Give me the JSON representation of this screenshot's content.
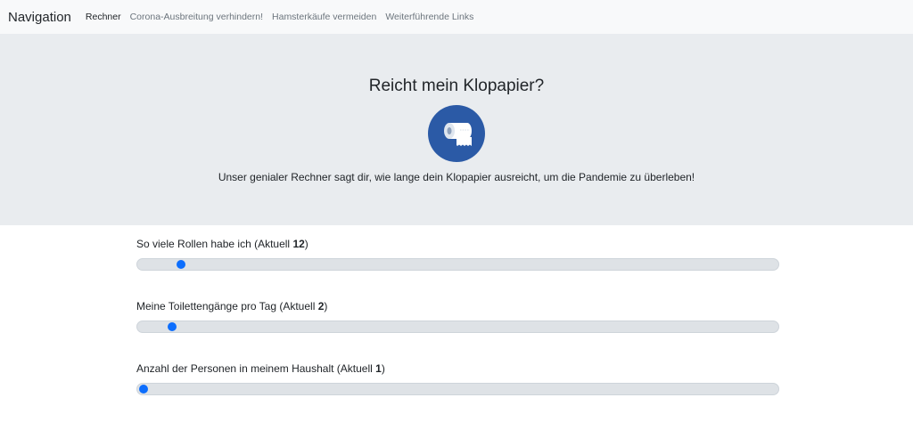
{
  "navbar": {
    "brand": "Navigation",
    "links": [
      {
        "label": "Rechner",
        "active": true
      },
      {
        "label": "Corona-Ausbreitung verhindern!",
        "active": false
      },
      {
        "label": "Hamsterkäufe vermeiden",
        "active": false
      },
      {
        "label": "Weiterführende Links",
        "active": false
      }
    ]
  },
  "hero": {
    "title": "Reicht mein Klopapier?",
    "icon": "toilet-paper-icon",
    "icon_bg": "#2b5aa6",
    "description": "Unser genialer Rechner sagt dir, wie lange dein Klopapier ausreicht, um die Pandemie zu überleben!"
  },
  "sliders": [
    {
      "label": "So viele Rollen habe ich (Aktuell ",
      "value": "12",
      "suffix": ")",
      "fraction": 0.06
    },
    {
      "label": "Meine Toilettengänge pro Tag (Aktuell ",
      "value": "2",
      "suffix": ")",
      "fraction": 0.045
    },
    {
      "label": "Anzahl der Personen in meinem Haushalt (Aktuell ",
      "value": "1",
      "suffix": ")",
      "fraction": 0.0
    }
  ],
  "colors": {
    "accent": "#0d6efd",
    "hero_bg": "#e9ecef",
    "navbar_bg": "#f8f9fa"
  }
}
